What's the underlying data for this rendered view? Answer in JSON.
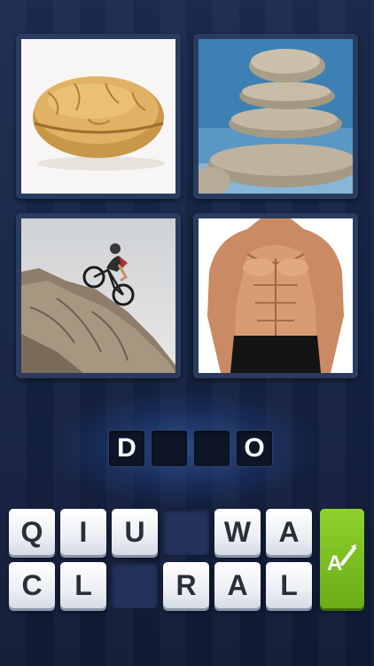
{
  "puzzle": {
    "pictures": [
      {
        "icon": "walnut-image"
      },
      {
        "icon": "stacked-stones-image"
      },
      {
        "icon": "mountain-biker-image"
      },
      {
        "icon": "muscular-torso-image"
      }
    ]
  },
  "answer": {
    "slots": [
      "D",
      "",
      "",
      "O"
    ]
  },
  "letters": {
    "row1": [
      "Q",
      "I",
      "U",
      "",
      "W",
      "A"
    ],
    "row2": [
      "C",
      "L",
      "",
      "R",
      "A",
      "L"
    ]
  },
  "hint_button": {
    "icon": "magic-wand-icon",
    "label": "A"
  },
  "colors": {
    "background": "#162444",
    "hint_green": "#7cc021",
    "slot_dark": "#0d1629",
    "key_white": "#ffffff"
  }
}
